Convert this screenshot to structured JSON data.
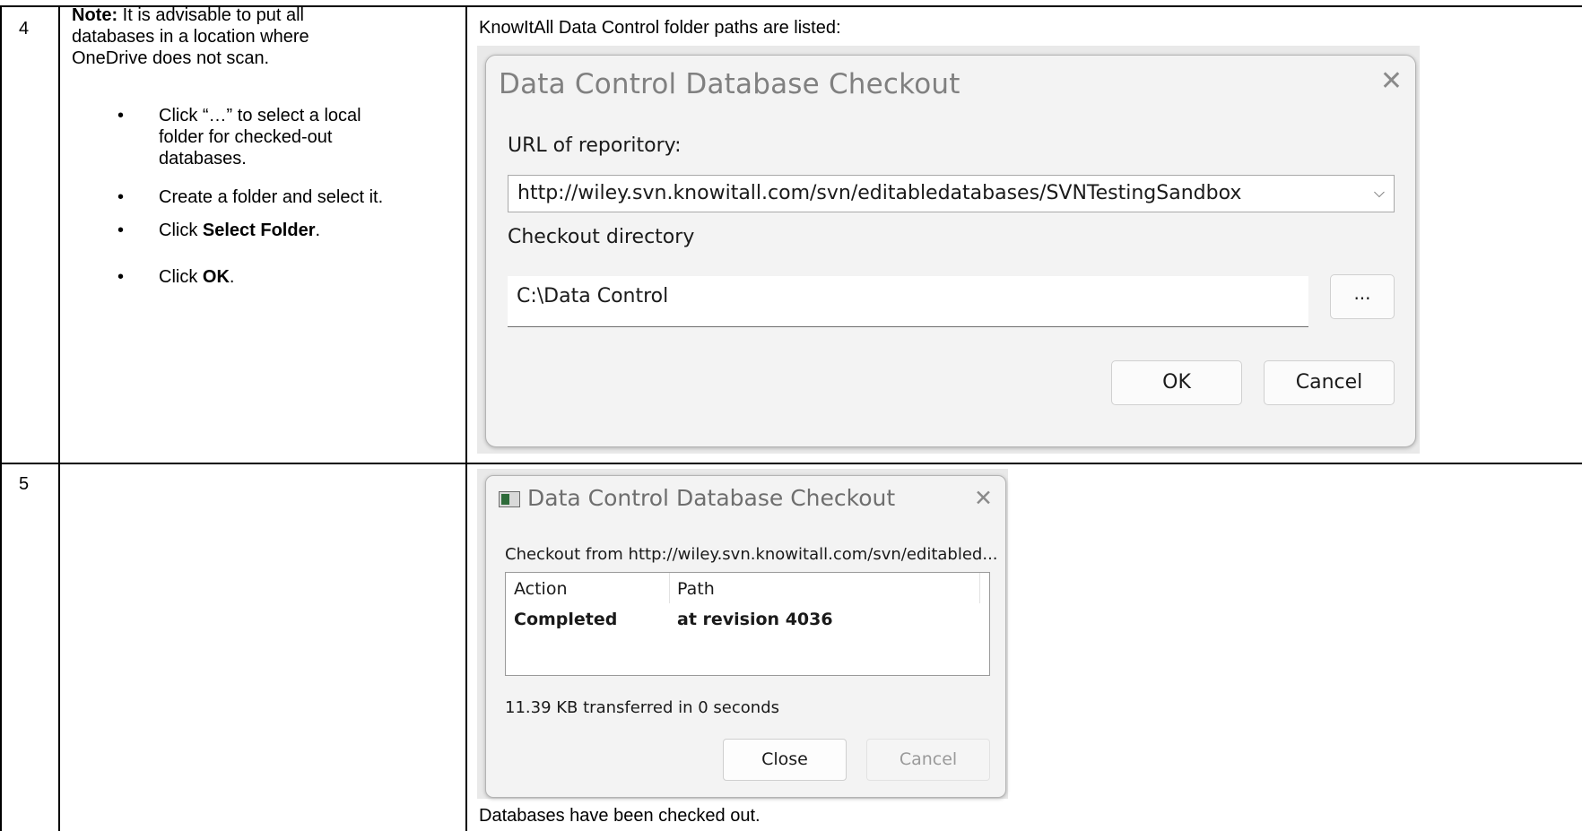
{
  "rows": [
    {
      "number": "4",
      "note_label": "Note:",
      "note_line1": " It is advisable to put all",
      "note_line2": "databases in a location where",
      "note_line3": "OneDrive does not scan.",
      "step1_line1": "Click “…” to select a local",
      "step1_line2": "folder for checked-out",
      "step1_line3": "databases.",
      "step2": "Create a folder and select it.",
      "step3_prefix": "Click ",
      "step3_bold": "Select Folder",
      "step3_suffix": ".",
      "step4_prefix": "Click ",
      "step4_bold": "OK",
      "step4_suffix": ".",
      "result_caption": "KnowItAll Data Control folder paths are listed:"
    },
    {
      "number": "5",
      "result_caption": "Databases have been checked out."
    }
  ],
  "bullet": "•",
  "dialog1": {
    "title": "Data Control Database Checkout",
    "close_glyph": "✕",
    "url_label": "URL of reporitory:",
    "url_value": "http://wiley.svn.knowitall.com/svn/editabledatabases/SVNTestingSandbox",
    "dropdown_glyph": "⌵",
    "dir_label": "Checkout directory",
    "dir_value": "C:\\Data Control",
    "browse_label": "...",
    "ok_label": "OK",
    "cancel_label": "Cancel"
  },
  "dialog2": {
    "title": "Data Control Database Checkout",
    "close_glyph": "✕",
    "message": "Checkout from http://wiley.svn.knowitall.com/svn/editabled...",
    "columns": [
      "Action",
      "Path"
    ],
    "rows": [
      {
        "action": "Completed",
        "path": "at revision 4036"
      }
    ],
    "info": "11.39 KB transferred in 0 seconds",
    "close_label": "Close",
    "cancel_label": "Cancel"
  }
}
